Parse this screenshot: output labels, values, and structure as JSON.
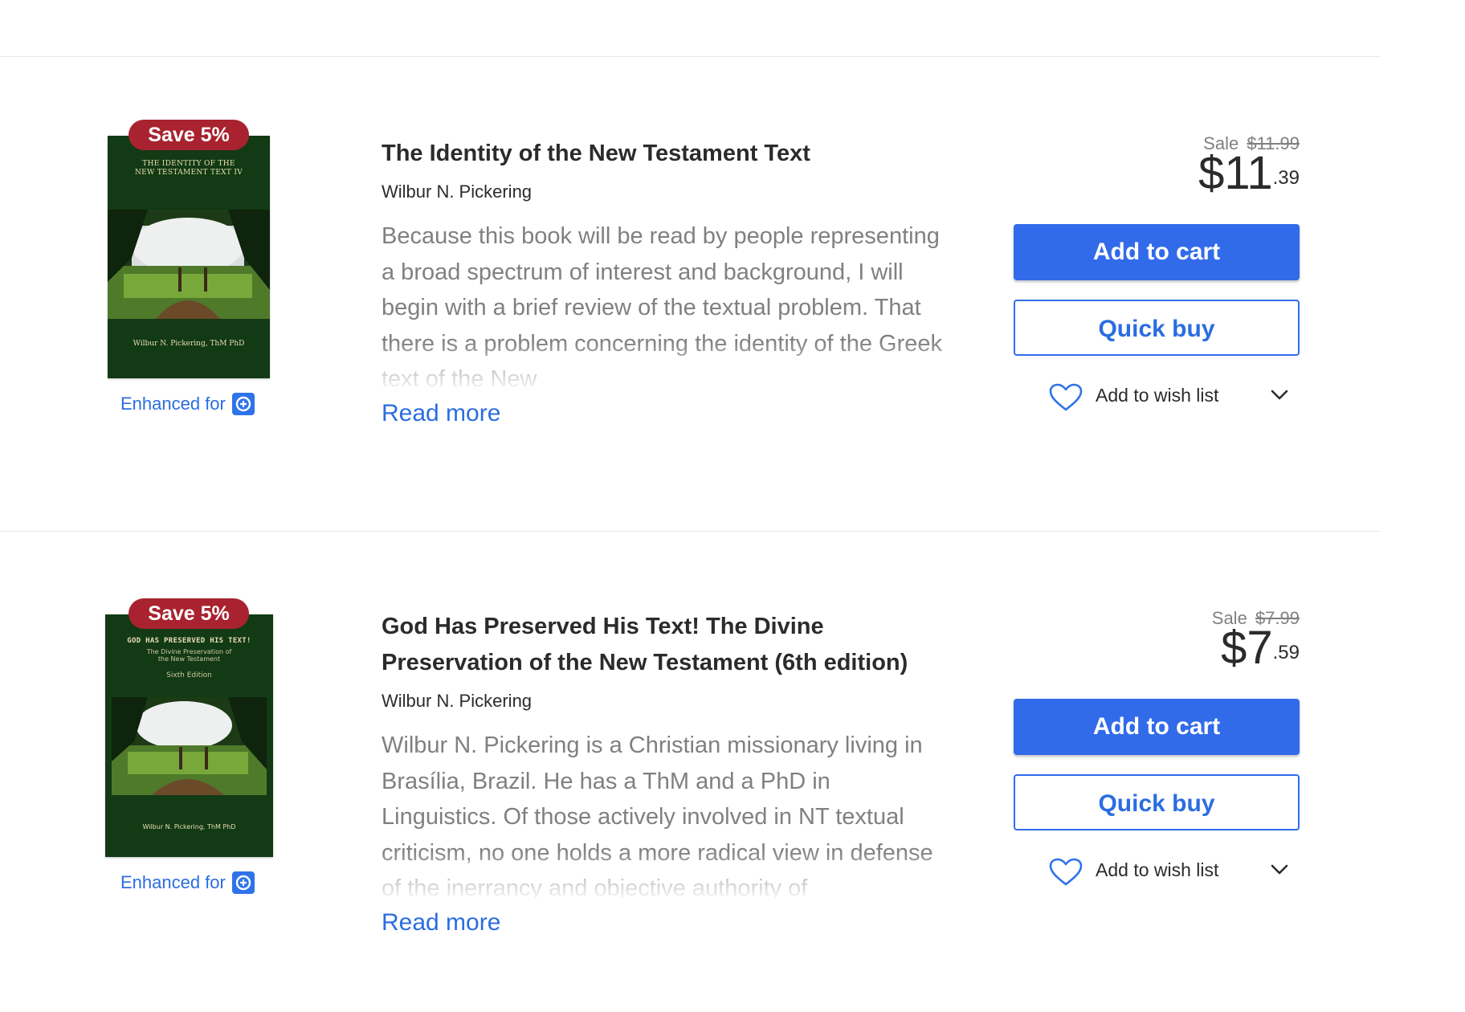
{
  "products": [
    {
      "badge": "Save 5%",
      "cover": {
        "title": "THE IDENTITY OF THE NEW TESTAMENT TEXT IV",
        "edition": "",
        "author": "Wilbur N. Pickering, ThM PhD"
      },
      "enhanced_label": "Enhanced for",
      "title": "The Identity of the New Testament Text",
      "author": "Wilbur N. Pickering",
      "description": "Because this book will be read by people representing a broad spectrum of interest and background, I will begin with a brief review of the textual problem. That there is a problem concerning the identity of the Greek text of the New",
      "read_more": "Read more",
      "sale_label": "Sale",
      "original_price": "$11.99",
      "price_dollars": "$11",
      "price_cents": ".39",
      "add_to_cart": "Add to cart",
      "quick_buy": "Quick buy",
      "wish_list": "Add to wish list"
    },
    {
      "badge": "Save 5%",
      "cover": {
        "title": "GOD HAS PRESERVED HIS TEXT!",
        "subtitle": "The Divine Preservation of the New Testament",
        "edition": "Sixth Edition",
        "author": "Wilbur N. Pickering, ThM PhD"
      },
      "enhanced_label": "Enhanced for",
      "title": "God Has Preserved His Text! The Divine Preservation of the New Testament (6th edition)",
      "author": "Wilbur N. Pickering",
      "description": "Wilbur N. Pickering is a Christian missionary living in Brasília, Brazil. He has a ThM and a PhD in Linguistics. Of those actively involved in NT textual criticism, no one holds a more radical view in defense of the inerrancy and objective authority of",
      "read_more": "Read more",
      "sale_label": "Sale",
      "original_price": "$7.99",
      "price_dollars": "$7",
      "price_cents": ".59",
      "add_to_cart": "Add to cart",
      "quick_buy": "Quick buy",
      "wish_list": "Add to wish list"
    }
  ],
  "colors": {
    "accent_blue": "#316bea",
    "link_blue": "#2b6de0",
    "badge_red": "#a8232f",
    "cover_green": "#123a14"
  },
  "icons": [
    "enhanced-for-logo-icon",
    "heart-icon",
    "chevron-down-icon"
  ]
}
